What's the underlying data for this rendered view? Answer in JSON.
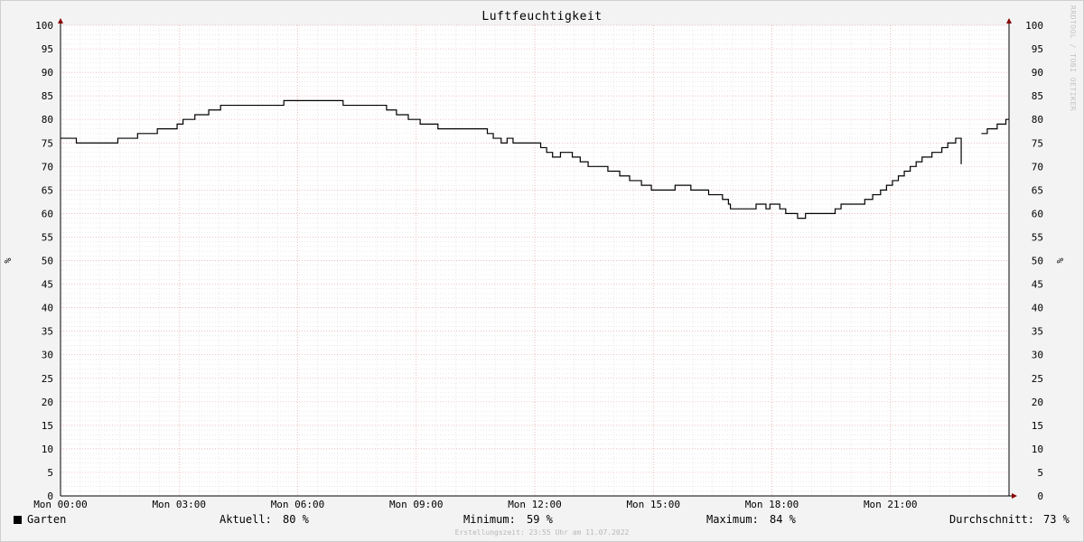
{
  "chart_data": {
    "type": "line",
    "title": "Luftfeuchtigkeit",
    "ylabel": "%",
    "ylabel_right": "%",
    "ylim": [
      0,
      100
    ],
    "y_ticks": [
      0,
      5,
      10,
      15,
      20,
      25,
      30,
      35,
      40,
      45,
      50,
      55,
      60,
      65,
      70,
      75,
      80,
      85,
      90,
      95,
      100
    ],
    "x_range_hours": [
      0,
      24
    ],
    "x_ticks": [
      {
        "hour": 0,
        "label": "Mon 00:00"
      },
      {
        "hour": 3,
        "label": "Mon 03:00"
      },
      {
        "hour": 6,
        "label": "Mon 06:00"
      },
      {
        "hour": 9,
        "label": "Mon 09:00"
      },
      {
        "hour": 12,
        "label": "Mon 12:00"
      },
      {
        "hour": 15,
        "label": "Mon 15:00"
      },
      {
        "hour": 18,
        "label": "Mon 18:00"
      },
      {
        "hour": 21,
        "label": "Mon 21:00"
      }
    ],
    "grid": true,
    "line_color": "#000000",
    "series": [
      {
        "name": "Garten",
        "step": true,
        "points": [
          [
            0.0,
            76
          ],
          [
            0.4,
            75
          ],
          [
            1.45,
            76
          ],
          [
            1.95,
            77
          ],
          [
            2.45,
            78
          ],
          [
            2.95,
            79
          ],
          [
            3.1,
            80
          ],
          [
            3.4,
            81
          ],
          [
            3.75,
            82
          ],
          [
            4.05,
            83
          ],
          [
            5.65,
            84
          ],
          [
            7.15,
            83
          ],
          [
            8.25,
            82
          ],
          [
            8.5,
            81
          ],
          [
            8.8,
            80
          ],
          [
            9.1,
            79
          ],
          [
            9.55,
            78
          ],
          [
            10.8,
            77
          ],
          [
            10.95,
            76
          ],
          [
            11.15,
            75
          ],
          [
            11.3,
            76
          ],
          [
            11.45,
            75
          ],
          [
            12.15,
            74
          ],
          [
            12.3,
            73
          ],
          [
            12.45,
            72
          ],
          [
            12.65,
            73
          ],
          [
            12.95,
            72
          ],
          [
            13.15,
            71
          ],
          [
            13.35,
            70
          ],
          [
            13.85,
            69
          ],
          [
            14.15,
            68
          ],
          [
            14.4,
            67
          ],
          [
            14.7,
            66
          ],
          [
            14.95,
            65
          ],
          [
            15.55,
            66
          ],
          [
            15.95,
            65
          ],
          [
            16.4,
            64
          ],
          [
            16.75,
            63
          ],
          [
            16.9,
            62
          ],
          [
            16.95,
            61
          ],
          [
            17.6,
            62
          ],
          [
            17.85,
            61
          ],
          [
            17.95,
            62
          ],
          [
            18.2,
            61
          ],
          [
            18.35,
            60
          ],
          [
            18.65,
            59
          ],
          [
            18.85,
            60
          ],
          [
            19.6,
            61
          ],
          [
            19.75,
            62
          ],
          [
            20.35,
            63
          ],
          [
            20.55,
            64
          ],
          [
            20.75,
            65
          ],
          [
            20.9,
            66
          ],
          [
            21.05,
            67
          ],
          [
            21.2,
            68
          ],
          [
            21.35,
            69
          ],
          [
            21.5,
            70
          ],
          [
            21.65,
            71
          ],
          [
            21.8,
            72
          ],
          [
            22.05,
            73
          ],
          [
            22.3,
            74
          ],
          [
            22.45,
            75
          ],
          [
            22.65,
            76
          ],
          [
            22.75,
            76
          ],
          [
            22.79,
            70.5
          ]
        ]
      },
      {
        "name": "Garten",
        "step": true,
        "points": [
          [
            23.3,
            77
          ],
          [
            23.45,
            78
          ],
          [
            23.7,
            79
          ],
          [
            23.92,
            80
          ],
          [
            24.0,
            80
          ]
        ]
      }
    ]
  },
  "legend": {
    "series_name": "Garten",
    "aktuell_label": "Aktuell:",
    "aktuell_value": "80 %",
    "minimum_label": "Minimum:",
    "minimum_value": "59 %",
    "maximum_label": "Maximum:",
    "maximum_value": "84 %",
    "durchschnitt_label": "Durchschnitt:",
    "durchschnitt_value": "73 %"
  },
  "watermark": "RRDTOOL / TOBI OETIKER",
  "footer": "Erstellungszeit: 23:55 Uhr am 11.07.2022"
}
